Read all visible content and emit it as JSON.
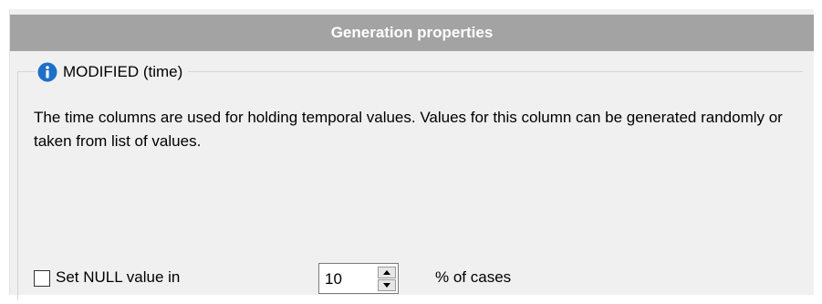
{
  "header": {
    "title": "Generation properties"
  },
  "group": {
    "title": "MODIFIED (time)",
    "icon": "info-icon",
    "description": "The time columns are used for holding temporal values. Values for this column can be generated randomly or taken from list of values."
  },
  "null_option": {
    "checkbox_label": "Set NULL value in",
    "checked": false,
    "percent_value": "10",
    "suffix_label": "% of cases"
  },
  "colors": {
    "header_bg": "#a3a3a3",
    "panel_bg": "#f0f0f0",
    "info_icon": "#1e6fc9"
  }
}
